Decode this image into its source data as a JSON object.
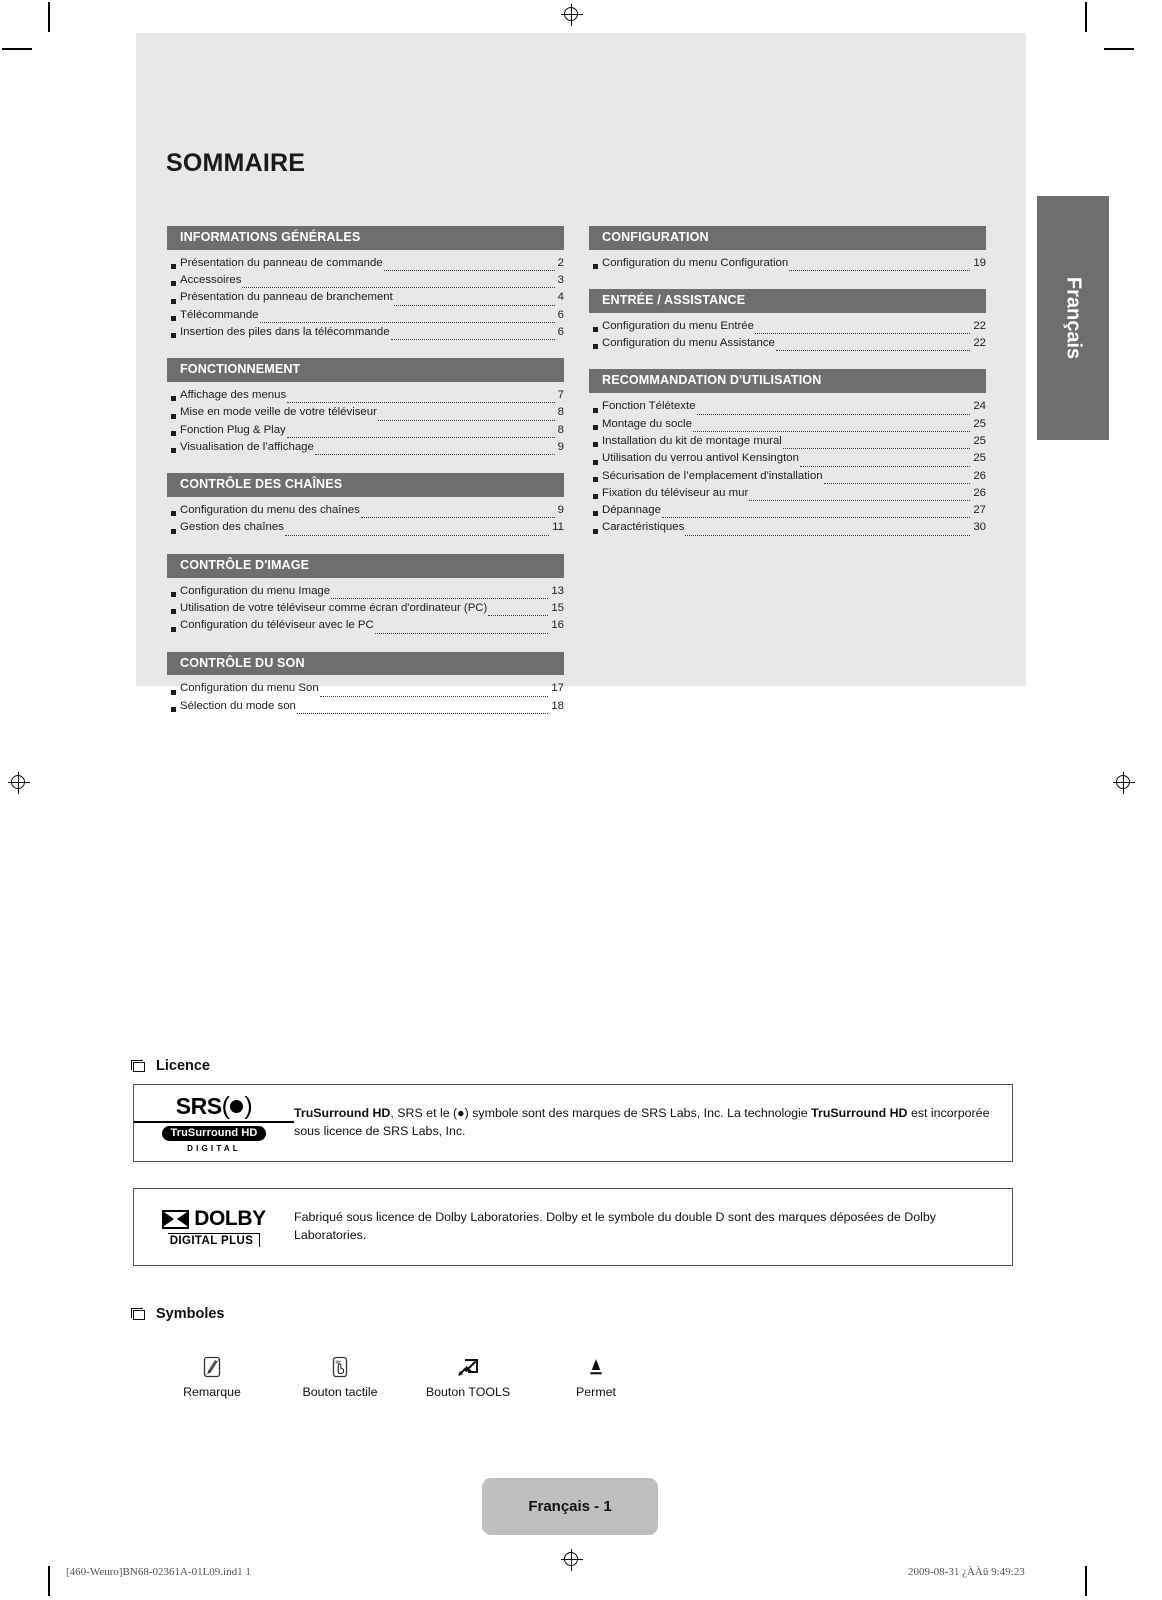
{
  "document": {
    "title": "SOMMAIRE",
    "language_tab": "Français",
    "page_label": "Français - 1"
  },
  "toc": {
    "left_column": [
      {
        "heading": "INFORMATIONS GÉNÉRALES",
        "entries": [
          {
            "label": "Présentation du panneau de commande",
            "page": "2"
          },
          {
            "label": "Accessoires",
            "page": "3"
          },
          {
            "label": "Présentation du panneau de branchement",
            "page": "4"
          },
          {
            "label": "Télécommande",
            "page": "6"
          },
          {
            "label": "Insertion des piles dans la télécommande",
            "page": "6"
          }
        ]
      },
      {
        "heading": "FONCTIONNEMENT",
        "entries": [
          {
            "label": "Affichage des menus",
            "page": "7"
          },
          {
            "label": "Mise en mode veille de votre téléviseur",
            "page": "8"
          },
          {
            "label": "Fonction Plug & Play",
            "page": "8"
          },
          {
            "label": "Visualisation de l’affichage",
            "page": "9"
          }
        ]
      },
      {
        "heading": "CONTRÔLE DES CHAÎNES",
        "entries": [
          {
            "label": "Configuration du menu des chaînes",
            "page": "9"
          },
          {
            "label": "Gestion des chaînes",
            "page": "11"
          }
        ]
      },
      {
        "heading": "CONTRÔLE D'IMAGE",
        "entries": [
          {
            "label": "Configuration du menu Image",
            "page": "13"
          },
          {
            "label": "Utilisation de votre téléviseur comme écran d'ordinateur (PC)",
            "page": "15"
          },
          {
            "label": "Configuration du téléviseur avec le PC",
            "page": "16"
          }
        ]
      },
      {
        "heading": "CONTRÔLE DU SON",
        "entries": [
          {
            "label": "Configuration du menu Son",
            "page": "17"
          },
          {
            "label": "Sélection du mode son",
            "page": "18"
          }
        ]
      }
    ],
    "right_column": [
      {
        "heading": "CONFIGURATION",
        "entries": [
          {
            "label": "Configuration du menu Configuration",
            "page": "19"
          }
        ]
      },
      {
        "heading": "ENTRÉE / ASSISTANCE",
        "entries": [
          {
            "label": "Configuration du menu Entrée",
            "page": "22"
          },
          {
            "label": "Configuration du menu Assistance",
            "page": "22"
          }
        ]
      },
      {
        "heading": "RECOMMANDATION D'UTILISATION",
        "entries": [
          {
            "label": "Fonction Télétexte",
            "page": "24"
          },
          {
            "label": "Montage du socle",
            "page": "25"
          },
          {
            "label": "Installation du kit de montage mural",
            "page": "25"
          },
          {
            "label": "Utilisation du verrou antivol Kensington",
            "page": "25"
          },
          {
            "label": "Sécurisation de l’emplacement d'installation",
            "page": "26"
          },
          {
            "label": "Fixation du téléviseur au mur",
            "page": "26"
          },
          {
            "label": "Dépannage",
            "page": "27"
          },
          {
            "label": "Caractéristiques",
            "page": "30"
          }
        ]
      }
    ]
  },
  "licence": {
    "heading": "Licence",
    "items": [
      {
        "logo": "srs-trusurround-hd-logo",
        "logo_text": {
          "brand": "SRS",
          "pill": "TruSurround HD",
          "sub": "DIGITAL"
        },
        "text_parts": [
          {
            "t": "TruSurround HD",
            "bold": true
          },
          {
            "t": ", SRS et le ",
            "bold": false
          },
          {
            "t": "(●)",
            "bold": false
          },
          {
            "t": " symbole sont des marques de SRS Labs, Inc. La technologie ",
            "bold": false
          },
          {
            "t": "TruSurround HD",
            "bold": true
          },
          {
            "t": " est incorporée sous licence de SRS Labs, Inc.",
            "bold": false
          }
        ]
      },
      {
        "logo": "dolby-digital-plus-logo",
        "logo_text": {
          "brand": "DOLBY",
          "sub": "DIGITAL PLUS"
        },
        "text_parts": [
          {
            "t": "Fabriqué sous licence de Dolby Laboratories. Dolby et le symbole du double D sont des marques déposées de Dolby Laboratories.",
            "bold": false
          }
        ]
      }
    ]
  },
  "symbols": {
    "heading": "Symboles",
    "items": [
      {
        "icon": "note-pencil-icon",
        "label": "Remarque"
      },
      {
        "icon": "touch-button-icon",
        "label": "Bouton tactile"
      },
      {
        "icon": "tools-button-icon",
        "label": "Bouton TOOLS"
      },
      {
        "icon": "press-enter-icon",
        "label": "Permet"
      }
    ]
  },
  "print_footer": {
    "left": "[460-Weuro]BN68-02361A-01L09.ind1   1",
    "right": "2009-08-31   ¿ÀÀü 9:49:23"
  },
  "colors": {
    "panel_bg": "#e8e8e8",
    "heading_bar": "#6e6e6e",
    "page_pill": "#bfbfbf",
    "text": "#1c1c1c"
  }
}
